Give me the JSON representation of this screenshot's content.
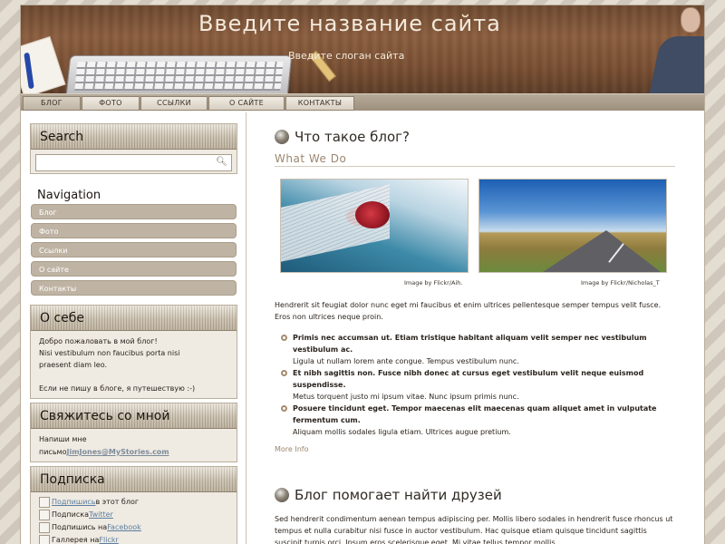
{
  "header": {
    "site_title": "Введите название сайта",
    "slogan": "Введите слоган сайта"
  },
  "nav": {
    "items": [
      "БЛОГ",
      "ФОТО",
      "ССЫЛКИ",
      "О САЙТЕ",
      "КОНТАКТЫ"
    ],
    "active_index": 0
  },
  "sidebar": {
    "search": {
      "title": "Search",
      "value": "",
      "icon": "search-icon"
    },
    "navigation": {
      "title": "Navigation",
      "links": [
        "Блог",
        "Фото",
        "Ссылки",
        "О сайте",
        "Контакты"
      ]
    },
    "about": {
      "title": "О себе",
      "lines": [
        "Добро пожаловать в мой блог!",
        "Nisi vestibulum non faucibus porta nisi",
        "praesent diam leo.",
        "",
        "Если не пишу в блоге, я путешествую :-)"
      ]
    },
    "contact": {
      "title": "Свяжитесь со мной",
      "line1": "Напиши мне",
      "line2_prefix": "письмо",
      "email": "JimJones@MyStories.com"
    },
    "subscribe": {
      "title": "Подписка",
      "items": [
        {
          "link": "Подпишись",
          "text": "в этот блог",
          "link_first": true
        },
        {
          "text": "Подписка",
          "link": "Twitter",
          "link_first": false
        },
        {
          "text": "Подпишись на",
          "link": "Facebook",
          "link_first": false
        },
        {
          "text": "Галлерея на",
          "link": "Flickr",
          "link_first": false
        }
      ]
    }
  },
  "post1": {
    "title": "Что такое блог?",
    "subtitle": "What We Do",
    "captions": [
      "Image by Flickr/Aih.",
      "Image by Flickr/Nicholas_T"
    ],
    "intro": "Hendrerit sit feugiat dolor nunc eget mi faucibus et enim ultrices pellentesque semper tempus velit fusce. Eros non ultrices neque proin.",
    "items": [
      {
        "bold": "Primis nec accumsan ut. Etiam tristique habitant aliquam velit semper nec vestibulum vestibulum ac.",
        "text": "Ligula ut nullam lorem ante congue. Tempus vestibulum nunc."
      },
      {
        "bold": "Et nibh sagittis non. Fusce nibh donec at cursus eget vestibulum velit neque euismod suspendisse.",
        "text": "Metus torquent justo mi ipsum vitae. Nunc ipsum primis nunc."
      },
      {
        "bold": "Posuere tincidunt eget. Tempor maecenas elit maecenas quam aliquet amet in vulputate fermentum cum.",
        "text": "Aliquam mollis sodales ligula etiam. Ultrices augue pretium."
      }
    ],
    "more": "More Info"
  },
  "post2": {
    "title": "Блог помогает найти друзей",
    "text": "Sed hendrerit condimentum aenean tempus adipiscing per. Mollis libero sodales in hendrerit fusce rhoncus ut tempus et nulla curabitur nisi fusce in auctor vestibulum. Hac quisque etiam quisque tincidunt sagittis suscipit turpis orci. Ipsum eros scelerisque eget. Mi vitae tellus tempor mollis"
  }
}
